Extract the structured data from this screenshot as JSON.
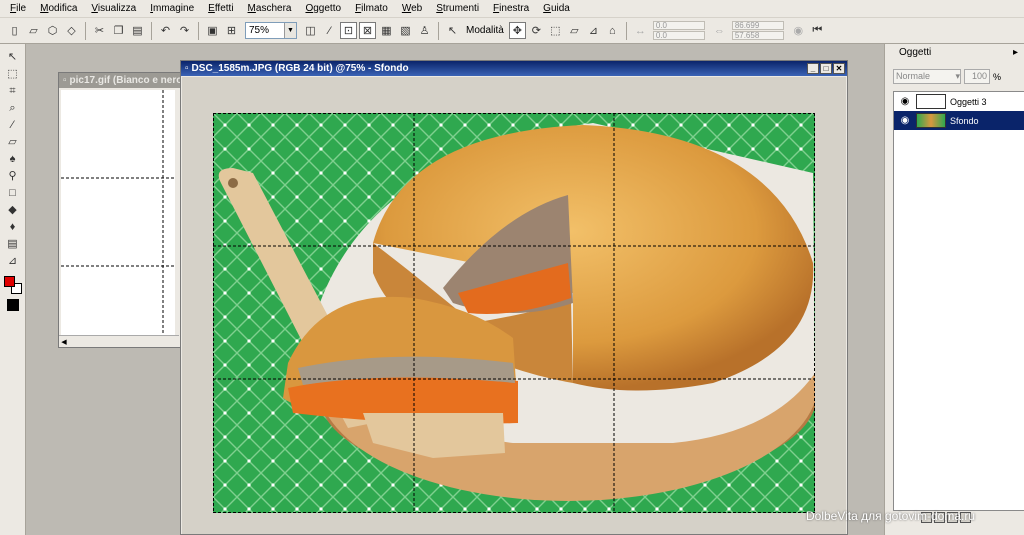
{
  "menu": [
    "File",
    "Modifica",
    "Visualizza",
    "Immagine",
    "Effetti",
    "Maschera",
    "Oggetto",
    "Filmato",
    "Web",
    "Strumenti",
    "Finestra",
    "Guida"
  ],
  "toolbar": {
    "zoom_value": "75%",
    "mode_label": "Modalità",
    "x_value": "0.0",
    "y_value": "0.0",
    "w_value": "86.699",
    "h_value": "57.658"
  },
  "window1": {
    "title": "pic17.gif (Bianco e nero"
  },
  "window2": {
    "title": "DSC_1585m.JPG (RGB 24 bit) @75% - Sfondo"
  },
  "panel": {
    "title": "Oggetti",
    "blend_mode": "Normale",
    "opacity": "100",
    "opacity_unit": "%",
    "layers": [
      {
        "name": "Oggetti 3",
        "selected": false
      },
      {
        "name": "Sfondo",
        "selected": true
      }
    ]
  },
  "watermark": "DolbeVita для gotovim-doma.ru",
  "colors": {
    "foreground": "#e00000",
    "background": "#ffffff",
    "title_active": "#0a246a",
    "tablecloth": "#2fa84f"
  }
}
